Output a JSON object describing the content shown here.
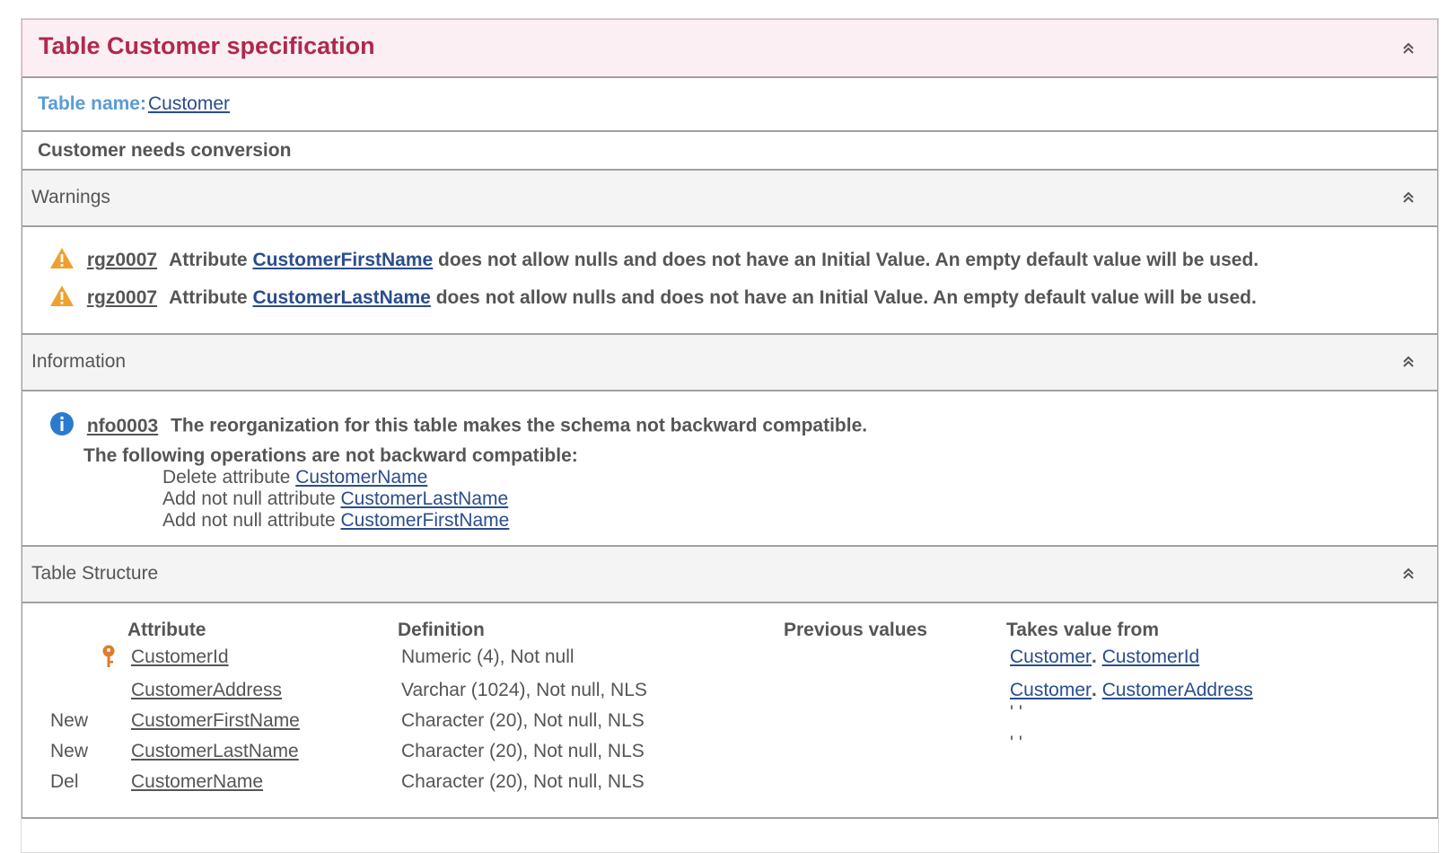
{
  "spec": {
    "title": "Table Customer specification"
  },
  "table_name": {
    "label": "Table name: ",
    "value": "Customer"
  },
  "conversion_text": "Customer needs conversion",
  "warnings": {
    "title": "Warnings",
    "items": [
      {
        "code": "rgz0007",
        "pre": "Attribute",
        "attribute": "CustomerFirstName",
        "post": "does not allow nulls and does not have an Initial Value. An empty default value will be used."
      },
      {
        "code": "rgz0007",
        "pre": "Attribute",
        "attribute": "CustomerLastName",
        "post": "does not allow nulls and does not have an Initial Value. An empty default value will be used."
      }
    ]
  },
  "information": {
    "title": "Information",
    "code": "nfo0003",
    "message": "The reorganization for this table makes the schema not backward compatible.",
    "ops_title": "The following operations are not backward compatible:",
    "ops": [
      {
        "text": "Delete attribute ",
        "attribute": "CustomerName"
      },
      {
        "text": "Add not null attribute ",
        "attribute": "CustomerLastName"
      },
      {
        "text": "Add not null attribute ",
        "attribute": "CustomerFirstName"
      }
    ]
  },
  "structure": {
    "title": "Table Structure",
    "headers": {
      "attribute": "Attribute",
      "definition": "Definition",
      "previous": "Previous values",
      "takes": "Takes value from"
    },
    "rows": [
      {
        "status": "",
        "key": true,
        "attribute": "CustomerId",
        "definition": "Numeric (4), Not null",
        "takes_table": "Customer",
        "takes_attr": "CustomerId",
        "takes_text": ""
      },
      {
        "status": "",
        "key": false,
        "attribute": "CustomerAddress",
        "definition": "Varchar (1024), Not null, NLS",
        "takes_table": "Customer",
        "takes_attr": "CustomerAddress",
        "takes_text": ""
      },
      {
        "status": "New",
        "key": false,
        "attribute": "CustomerFirstName",
        "definition": "Character (20), Not null, NLS",
        "takes_table": "",
        "takes_attr": "",
        "takes_text": "' '"
      },
      {
        "status": "New",
        "key": false,
        "attribute": "CustomerLastName",
        "definition": "Character (20), Not null, NLS",
        "takes_table": "",
        "takes_attr": "",
        "takes_text": "' '"
      },
      {
        "status": "Del",
        "key": false,
        "attribute": "CustomerName",
        "definition": "Character (20), Not null, NLS",
        "takes_table": "",
        "takes_attr": "",
        "takes_text": ""
      }
    ]
  },
  "colors": {
    "title": "#b0284f",
    "link": "#2b4d8c",
    "label_blue": "#5b9bd5",
    "warning": "#f0a030",
    "info": "#2a7bd0"
  }
}
